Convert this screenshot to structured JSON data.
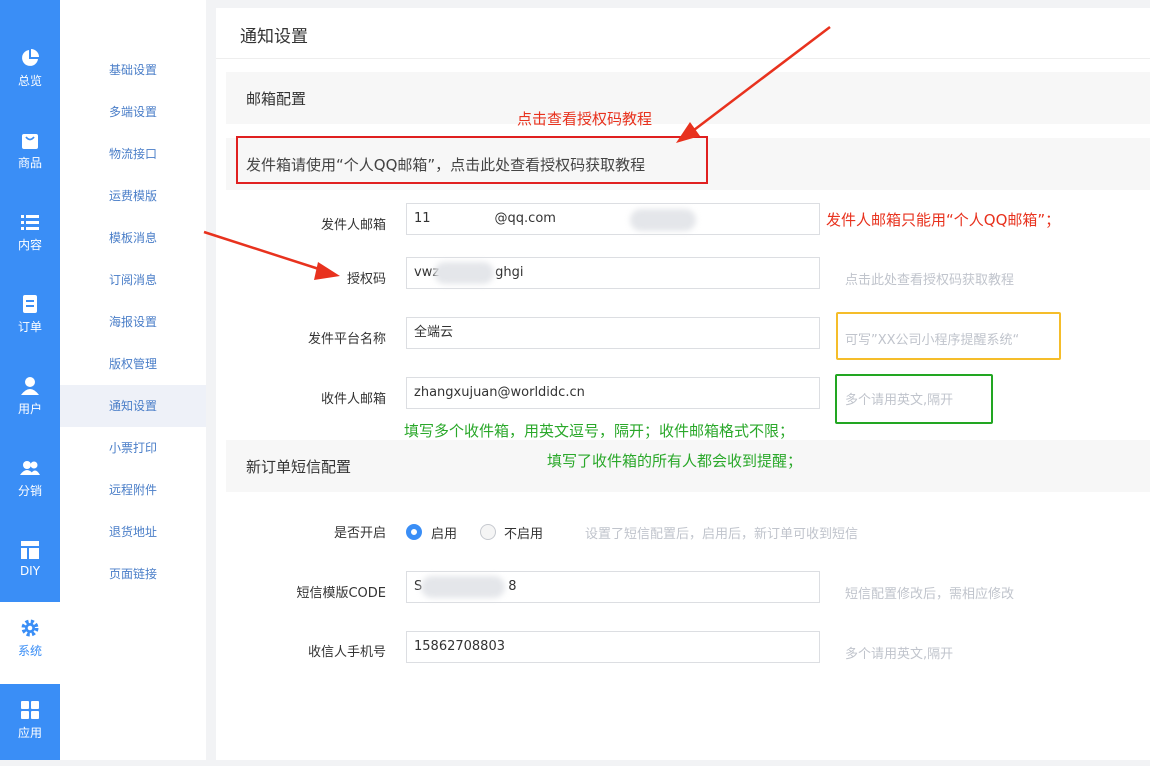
{
  "nav": [
    {
      "label": "总览",
      "icon": "pie-chart-icon"
    },
    {
      "label": "商品",
      "icon": "bag-icon"
    },
    {
      "label": "内容",
      "icon": "list-icon"
    },
    {
      "label": "订单",
      "icon": "document-icon"
    },
    {
      "label": "用户",
      "icon": "user-icon"
    },
    {
      "label": "分销",
      "icon": "users-icon"
    },
    {
      "label": "DIY",
      "icon": "layout-icon"
    },
    {
      "label": "系统",
      "icon": "gear-icon"
    },
    {
      "label": "应用",
      "icon": "grid-icon"
    }
  ],
  "submenu": [
    "基础设置",
    "多端设置",
    "物流接口",
    "运费模版",
    "模板消息",
    "订阅消息",
    "海报设置",
    "版权管理",
    "通知设置",
    "小票打印",
    "远程附件",
    "退货地址",
    "页面链接"
  ],
  "page": {
    "title": "通知设置"
  },
  "email": {
    "section_title": "邮箱配置",
    "notice": "发件箱请使用“个人QQ邮箱”，点击此处查看授权码获取教程",
    "sender_label": "发件人邮箱",
    "sender_value_prefix": "11",
    "sender_value_suffix": "@qq.com",
    "auth_label": "授权码",
    "auth_value_prefix": "vwz",
    "auth_value_suffix": "ghgi",
    "auth_hint": "点击此处查看授权码获取教程",
    "platform_label": "发件平台名称",
    "platform_value": "全端云",
    "platform_hint": "可写”XX公司小程序提醒系统“",
    "receiver_label": "收件人邮箱",
    "receiver_value": "zhangxujuan@worldidc.cn",
    "receiver_hint": "多个请用英文,隔开"
  },
  "sms": {
    "section_title": "新订单短信配置",
    "enable_label": "是否开启",
    "enable_on": "启用",
    "enable_off": "不启用",
    "enable_hint": "设置了短信配置后，启用后，新订单可收到短信",
    "code_label": "短信模版CODE",
    "code_prefix": "S",
    "code_suffix": "8",
    "code_hint": "短信配置修改后，需相应修改",
    "phone_label": "收信人手机号",
    "phone_value": "15862708803",
    "phone_hint": "多个请用英文,隔开"
  },
  "annotations": {
    "tutorial": "点击查看授权码教程",
    "sender_only": "发件人邮箱只能用“个人QQ邮箱”；",
    "multi_receivers": "填写多个收件箱，用英文逗号，隔开；收件邮箱格式不限；",
    "all_receive": "填写了收件箱的所有人都会收到提醒；",
    "red": "#e8321e",
    "green": "#2aa82a",
    "yellow": "#f5bd2a"
  },
  "colors": {
    "accent": "#3a8ef6"
  }
}
